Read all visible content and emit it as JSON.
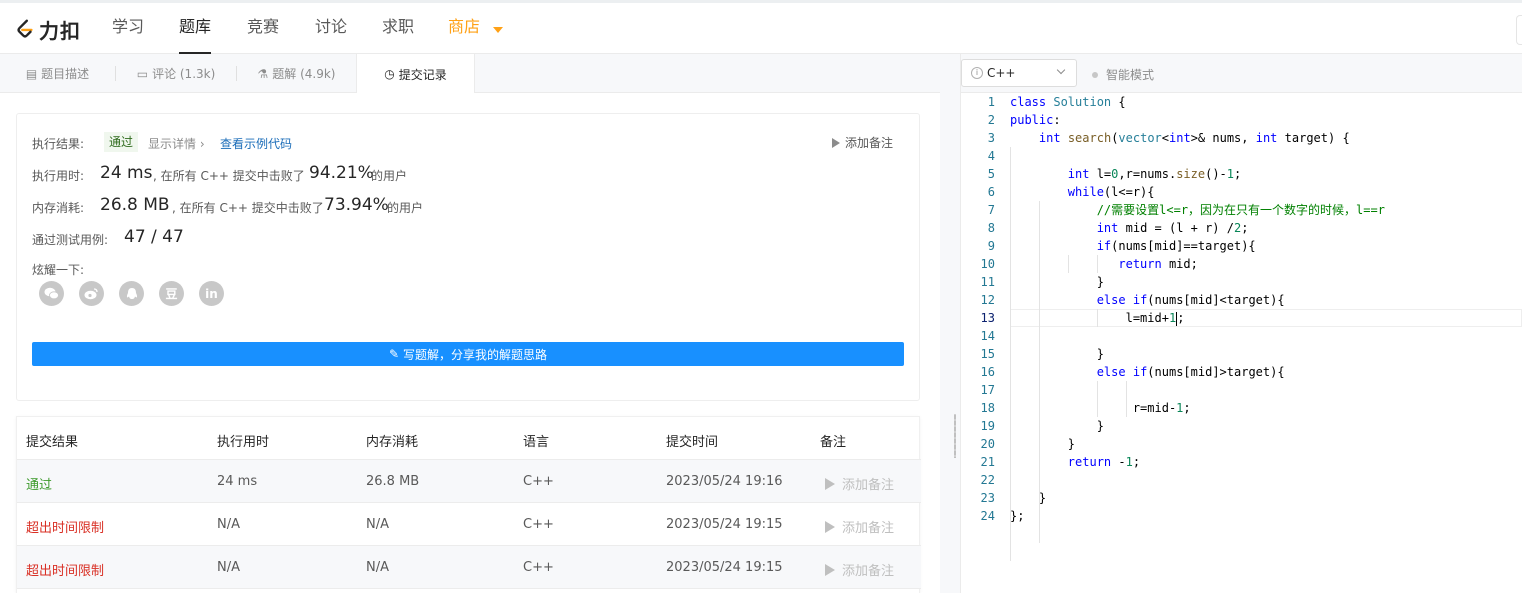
{
  "nav": {
    "logo_text": "力扣",
    "items": [
      "学习",
      "题库",
      "竞赛",
      "讨论",
      "求职"
    ],
    "shop": "商店",
    "accent": "#ffa116"
  },
  "tabs": [
    {
      "label": "题目描述",
      "icon": "doc-icon"
    },
    {
      "label": "评论 (1.3k)",
      "icon": "comment-icon"
    },
    {
      "label": "题解 (4.9k)",
      "icon": "flask-icon"
    },
    {
      "label": "提交记录",
      "icon": "clock-icon",
      "active": true
    }
  ],
  "result": {
    "label_status": "执行结果:",
    "status": "通过",
    "details": "显示详情 ›",
    "sample_code": "查看示例代码",
    "add_note": "添加备注",
    "label_time": "执行用时:",
    "time_value": "24 ms",
    "time_text": ", 在所有 C++ 提交中击败了",
    "time_percent": "94.21%",
    "users": "的用户",
    "label_mem": "内存消耗:",
    "mem_value": "26.8 MB",
    "mem_text": ", 在所有 C++ 提交中击败了",
    "mem_percent": "73.94%",
    "label_cases": "通过测试用例:",
    "cases_value": "47 / 47",
    "label_share": "炫耀一下:",
    "share_icons": [
      "wechat-icon",
      "weibo-icon",
      "qq-icon",
      "douban-icon",
      "linkedin-icon"
    ],
    "douban_glyph": "豆",
    "linkedin_glyph": "in",
    "write_button": "写题解，分享我的解题思路",
    "status_color": "#2f6b1d",
    "button_color": "#1890ff"
  },
  "table": {
    "headers": [
      "提交结果",
      "执行用时",
      "内存消耗",
      "语言",
      "提交时间",
      "备注"
    ],
    "rows": [
      {
        "result": "通过",
        "time": "24 ms",
        "mem": "26.8 MB",
        "lang": "C++",
        "date": "2023/05/24 19:16",
        "note": "添加备注"
      },
      {
        "result": "超出时间限制",
        "time": "N/A",
        "mem": "N/A",
        "lang": "C++",
        "date": "2023/05/24 19:15",
        "note": "添加备注"
      },
      {
        "result": "超出时间限制",
        "time": "N/A",
        "mem": "N/A",
        "lang": "C++",
        "date": "2023/05/24 19:15",
        "note": "添加备注"
      }
    ]
  },
  "editor": {
    "language": "C++",
    "smart_mode": "智能模式",
    "line_numbers": [
      "1",
      "2",
      "3",
      "4",
      "5",
      "6",
      "7",
      "8",
      "9",
      "10",
      "11",
      "12",
      "13",
      "14",
      "15",
      "16",
      "17",
      "18",
      "19",
      "20",
      "21",
      "22",
      "23",
      "24"
    ],
    "current_line": 13
  }
}
